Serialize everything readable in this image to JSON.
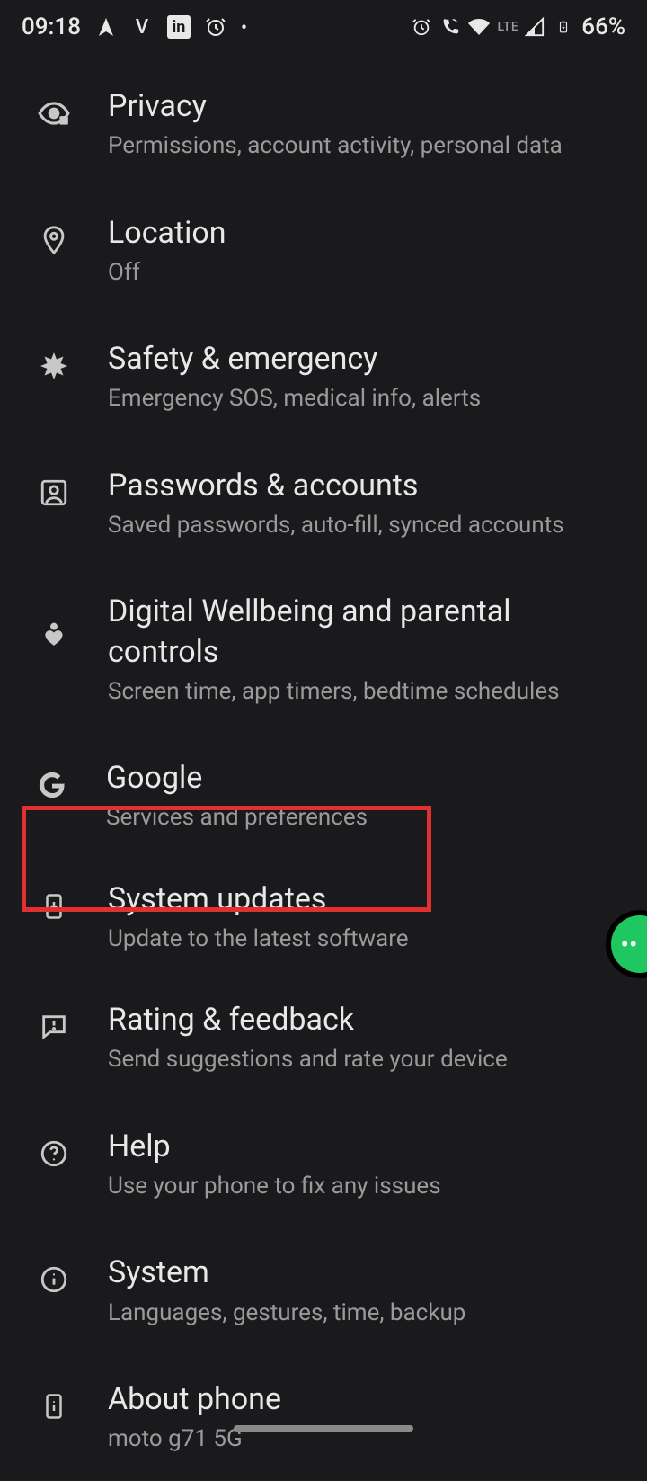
{
  "status": {
    "time": "09:18",
    "battery": "66%",
    "network_label": "LTE"
  },
  "settings": [
    {
      "title": "Privacy",
      "subtitle": "Permissions, account activity, personal data"
    },
    {
      "title": "Location",
      "subtitle": "Off"
    },
    {
      "title": "Safety & emergency",
      "subtitle": "Emergency SOS, medical info, alerts"
    },
    {
      "title": "Passwords & accounts",
      "subtitle": "Saved passwords, auto-fill, synced accounts"
    },
    {
      "title": "Digital Wellbeing and parental controls",
      "subtitle": "Screen time, app timers, bedtime schedules"
    },
    {
      "title": "Google",
      "subtitle": "Services and preferences"
    },
    {
      "title": "System updates",
      "subtitle": "Update to the latest software"
    },
    {
      "title": "Rating & feedback",
      "subtitle": "Send suggestions and rate your device"
    },
    {
      "title": "Help",
      "subtitle": "Use your phone to fix any issues"
    },
    {
      "title": "System",
      "subtitle": "Languages, gestures, time, backup"
    },
    {
      "title": "About phone",
      "subtitle": "moto g71 5G"
    }
  ]
}
